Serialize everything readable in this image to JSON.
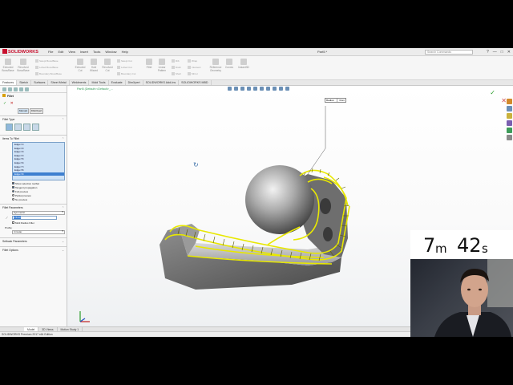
{
  "app": {
    "logo_text": "SOLIDWORKS",
    "menus": [
      "File",
      "Edit",
      "View",
      "Insert",
      "Tools",
      "Window",
      "Help"
    ],
    "document_title": "Part5 *",
    "search_placeholder": "Search Commands",
    "window_buttons": [
      "?",
      "—",
      "□",
      "✕"
    ]
  },
  "command_manager": {
    "large": [
      "Extruded Boss/Base",
      "Revolved Boss/Base",
      "Extruded Cut",
      "Hole Wizard",
      "Revolved Cut",
      "Fillet",
      "Linear Pattern",
      "Rib",
      "Reference Geometry",
      "Curves",
      "Instant3D"
    ],
    "small": [
      "Swept Boss/Base",
      "Lofted Boss/Base",
      "Boundary Boss/Base",
      "Swept Cut",
      "Lofted Cut",
      "Boundary Cut",
      "Draft",
      "Shell",
      "Wrap",
      "Intersect",
      "Mirror"
    ]
  },
  "tabs": [
    "Features",
    "Sketch",
    "Surfaces",
    "Sheet Metal",
    "Weldments",
    "Mold Tools",
    "Evaluate",
    "DimXpert",
    "SOLIDWORKS Add-Ins",
    "SOLIDWORKS MBD"
  ],
  "property_manager": {
    "title": "Fillet",
    "ok": "✓",
    "cancel": "✕",
    "subtabs": [
      "Manual",
      "FilletXpert"
    ],
    "fillet_type_title": "Fillet Type",
    "items_title": "Items To Fillet",
    "edges": [
      "Edge<1>",
      "Edge<2>",
      "Edge<3>",
      "Edge<4>",
      "Edge<5>",
      "Edge<6>",
      "Edge<7>",
      "Edge<8>",
      "Edge<9>"
    ],
    "options": [
      {
        "label": "Show selection toolbar",
        "checked": true
      },
      {
        "label": "Tangent propagation",
        "checked": true
      }
    ],
    "preview": [
      {
        "label": "Full preview",
        "selected": true
      },
      {
        "label": "Partial preview",
        "selected": false
      },
      {
        "label": "No preview",
        "selected": false
      }
    ],
    "params_title": "Fillet Parameters",
    "method": "Symmetric",
    "radius": "1.5mm",
    "multi_radius": "Multi Radius Fillet",
    "profile_label": "Profile:",
    "profile": "Circular",
    "setback_title": "Setback Parameters",
    "options_title": "Fillet Options"
  },
  "viewport": {
    "breadcrumb": "Part5 (Default<<Default>_...",
    "callout_label": "Radius:",
    "callout_value": "3mm"
  },
  "bottom_tabs": [
    "Model",
    "3D Views",
    "Motion Study 1"
  ],
  "status": "SOLIDWORKS Premium 2017 x64 Edition",
  "timer": {
    "minutes": "7",
    "min_unit": "m",
    "seconds": "42",
    "sec_unit": "s"
  },
  "colors": {
    "accent": "#c8102e",
    "highlight": "#e8e800",
    "selection": "#3d7fd0"
  }
}
